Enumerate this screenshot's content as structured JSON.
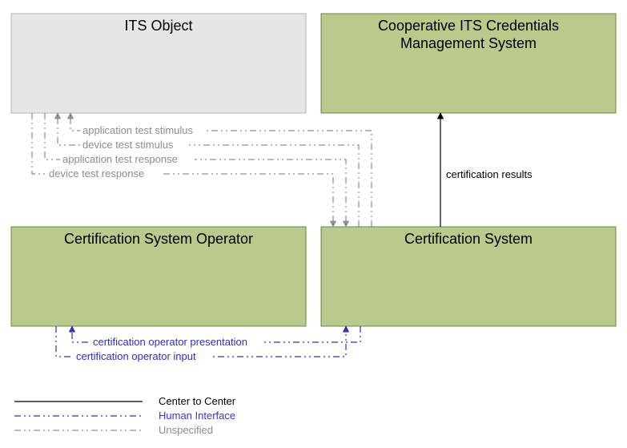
{
  "boxes": {
    "its_object": {
      "label": "ITS Object"
    },
    "ccms": {
      "line1": "Cooperative ITS Credentials",
      "line2": "Management System"
    },
    "cso": {
      "label": "Certification System Operator"
    },
    "cs": {
      "label": "Certification System"
    }
  },
  "flows": {
    "app_test_stimulus": "application test stimulus",
    "dev_test_stimulus": "device test stimulus",
    "app_test_response": "application test response",
    "dev_test_response": "device test response",
    "cert_results": "certification results",
    "cert_op_presentation": "certification operator presentation",
    "cert_op_input": "certification operator input"
  },
  "legend": {
    "c2c": "Center to Center",
    "human": "Human Interface",
    "unsp": "Unspecified"
  },
  "colors": {
    "green_fill": "#b8cb8d",
    "green_stroke": "#6f843f",
    "gray_fill": "#e6e6e6",
    "gray_stroke": "#b5b5b5",
    "line_gray": "#8d8d8d",
    "line_blue": "#2e2ec9",
    "line_black": "#000000"
  }
}
